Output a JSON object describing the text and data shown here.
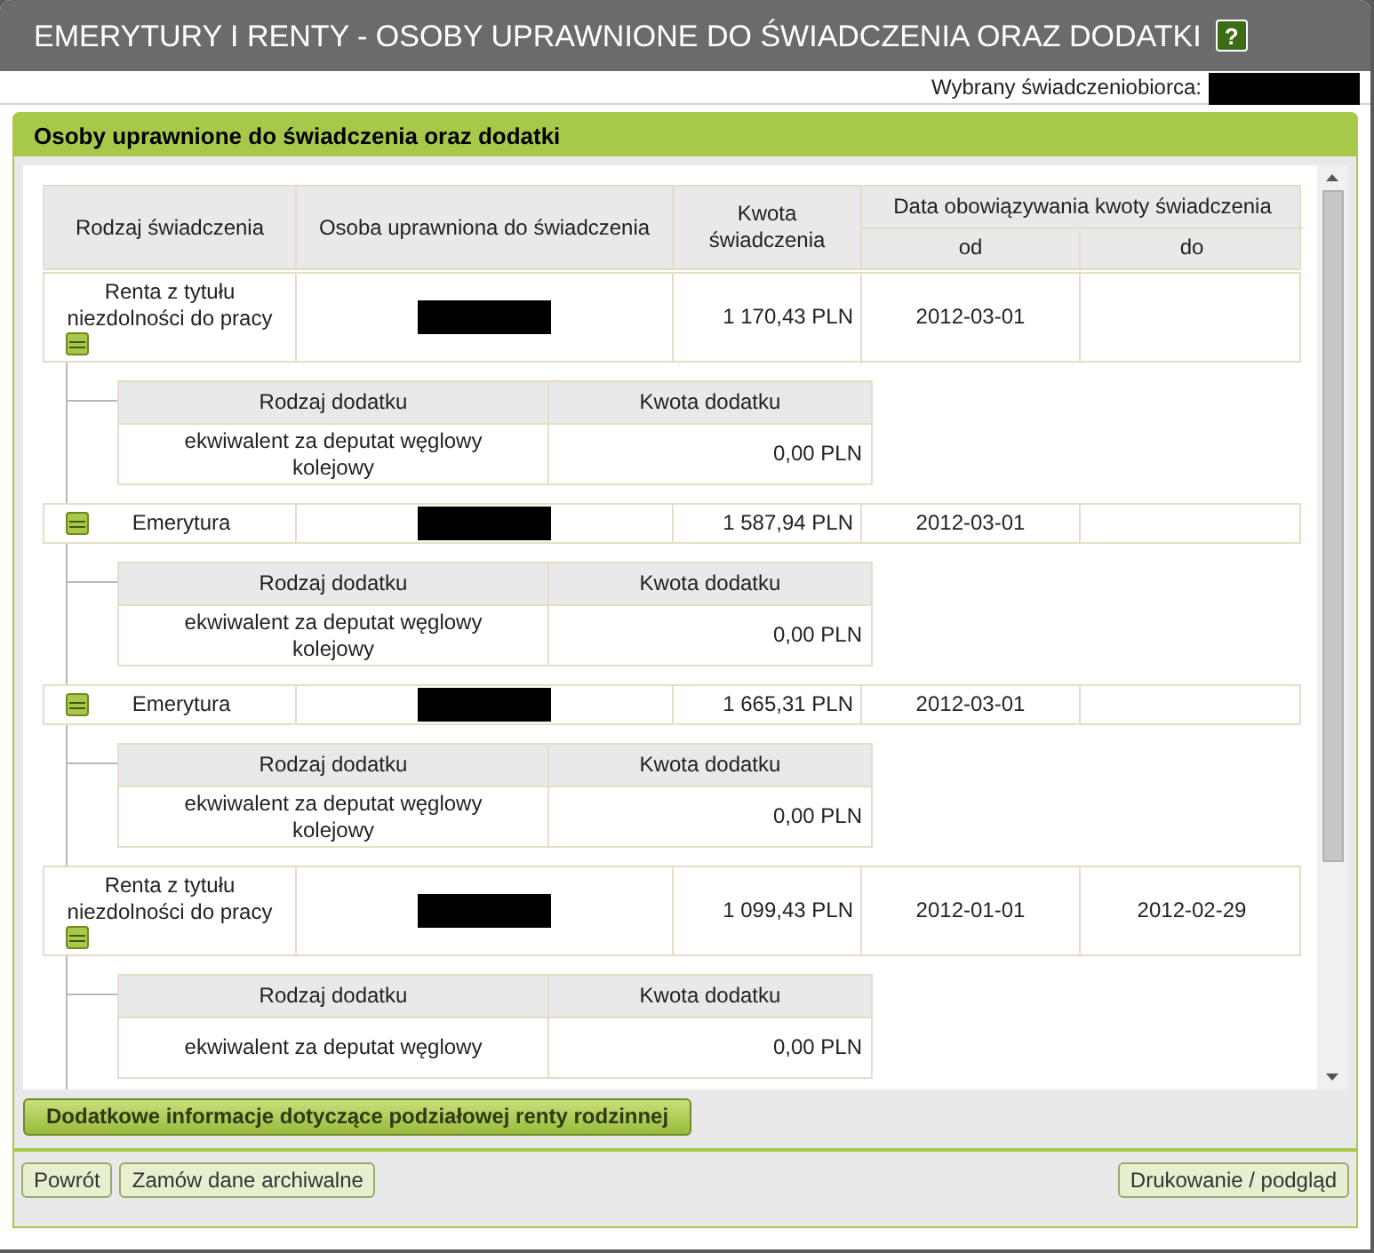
{
  "window": {
    "title": "EMERYTURY I RENTY - OSOBY UPRAWNIONE DO ŚWIADCZENIA ORAZ DODATKI",
    "help_label": "?"
  },
  "beneficiary": {
    "label": "Wybrany świadczeniobiorca:"
  },
  "panel": {
    "title": "Osoby uprawnione do świadczenia oraz dodatki"
  },
  "table": {
    "columns": [
      "Rodzaj świadczenia",
      "Osoba uprawniona do świadczenia",
      "Kwota świadczenia"
    ],
    "date_group": "Data obowiązywania kwoty świadczenia",
    "date_columns": [
      "od",
      "do"
    ],
    "rows": [
      {
        "type": "Renta z tytułu niezdolności do pracy",
        "amount": "1 170,43 PLN",
        "from": "2012-03-01",
        "to": "",
        "expanded": true,
        "addons": {
          "columns": [
            "Rodzaj dodatku",
            "Kwota dodatku"
          ],
          "rows": [
            {
              "type": "ekwiwalent za deputat węglowy kolejowy",
              "amount": "0,00 PLN"
            }
          ]
        }
      },
      {
        "type": "Emerytura",
        "amount": "1 587,94 PLN",
        "from": "2012-03-01",
        "to": "",
        "expanded": true,
        "addons": {
          "columns": [
            "Rodzaj dodatku",
            "Kwota dodatku"
          ],
          "rows": [
            {
              "type": "ekwiwalent za deputat węglowy kolejowy",
              "amount": "0,00 PLN"
            }
          ]
        }
      },
      {
        "type": "Emerytura",
        "amount": "1 665,31 PLN",
        "from": "2012-03-01",
        "to": "",
        "expanded": true,
        "addons": {
          "columns": [
            "Rodzaj dodatku",
            "Kwota dodatku"
          ],
          "rows": [
            {
              "type": "ekwiwalent za deputat węglowy kolejowy",
              "amount": "0,00 PLN"
            }
          ]
        }
      },
      {
        "type": "Renta z tytułu niezdolności do pracy",
        "amount": "1 099,43 PLN",
        "from": "2012-01-01",
        "to": "2012-02-29",
        "expanded": true,
        "addons": {
          "columns": [
            "Rodzaj dodatku",
            "Kwota dodatku"
          ],
          "rows": [
            {
              "type": "ekwiwalent za deputat węglowy",
              "amount": "0,00 PLN"
            }
          ]
        }
      }
    ]
  },
  "extra_button": "Dodatkowe informacje dotyczące podziałowej renty rodzinnej",
  "footer": {
    "left_buttons": [
      "Powrót",
      "Zamów dane archiwalne"
    ],
    "right_buttons": [
      "Drukowanie / podgląd"
    ]
  }
}
